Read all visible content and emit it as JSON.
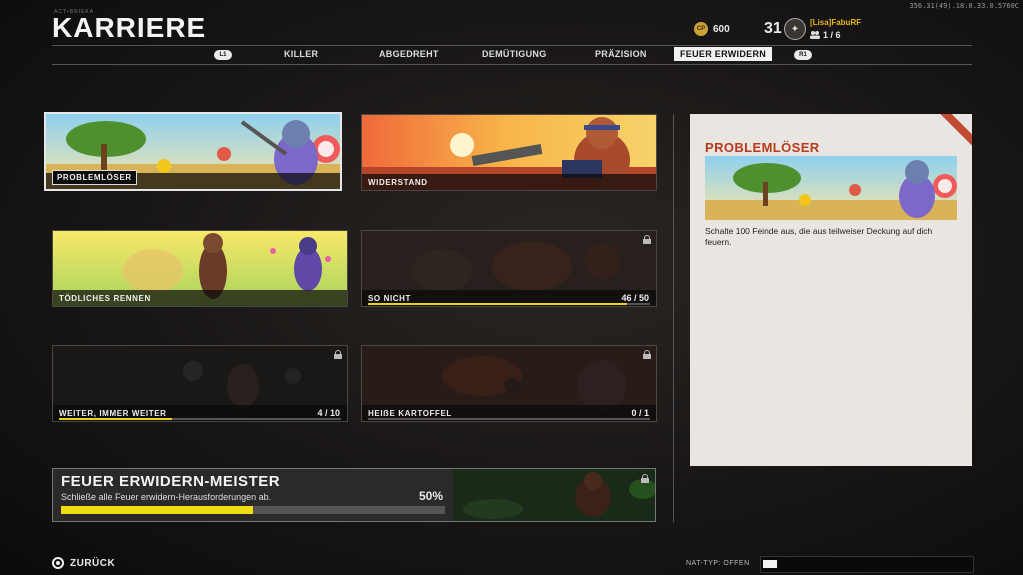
{
  "build": "356.31(49).18.0.33.0.5760C",
  "header": {
    "subtitle": "ACT•BRIEKA",
    "title": "KARRIERE",
    "cp_icon": "CP",
    "cp_amount": "600",
    "level": "31",
    "player_name": "[Lisa]FabuRF",
    "party": "1 / 6"
  },
  "tabs": {
    "left_button": "L1",
    "right_button": "R1",
    "items": [
      "KILLER",
      "ABGEDREHT",
      "DEMÜTIGUNG",
      "PRÄZISION",
      "FEUER ERWIDERN"
    ],
    "active": "FEUER ERWIDERN"
  },
  "cards": [
    {
      "label": "PROBLEMLÖSER",
      "count": "",
      "progress": null,
      "locked": false,
      "selected": true
    },
    {
      "label": "WIDERSTAND",
      "count": "",
      "progress": null,
      "locked": false,
      "selected": false
    },
    {
      "label": "TÖDLICHES RENNEN",
      "count": "",
      "progress": null,
      "locked": false,
      "selected": false
    },
    {
      "label": "SO NICHT",
      "count": "46 / 50",
      "progress": 0.92,
      "locked": true,
      "selected": false
    },
    {
      "label": "WEITER, IMMER WEITER",
      "count": "4 / 10",
      "progress": 0.4,
      "locked": true,
      "selected": false
    },
    {
      "label": "HEIẞE KARTOFFEL",
      "count": "0 / 1",
      "progress": 0.0,
      "locked": true,
      "selected": false
    }
  ],
  "master": {
    "title": "FEUER ERWIDERN-MEISTER",
    "description": "Schließe alle Feuer erwidern-Herausforderungen ab.",
    "percent_label": "50%",
    "progress": 0.5
  },
  "detail": {
    "title": "PROBLEMLÖSER",
    "description": "Schalte 100 Feinde aus, die aus teilweiser Deckung auf dich feuern."
  },
  "footer": {
    "back_label": "ZURÜCK",
    "nat_label": "NAT-TYP: OFFEN"
  },
  "colors": {
    "accent_yellow": "#e9d41a",
    "detail_title": "#b83a1c",
    "player_name": "#e6b81e"
  }
}
